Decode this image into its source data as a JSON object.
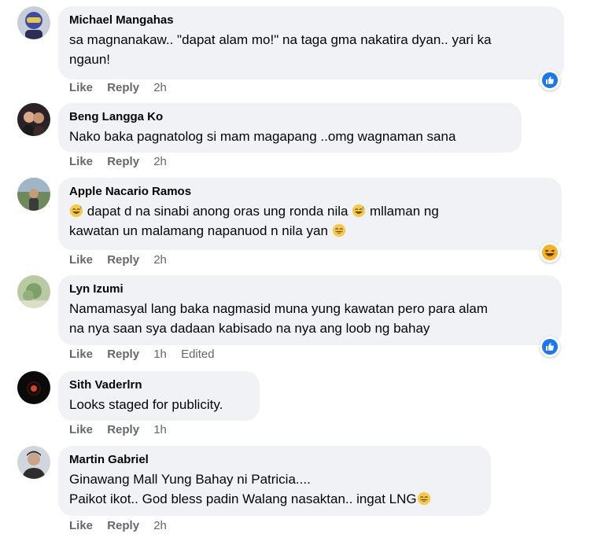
{
  "comments": [
    {
      "author": "Michael Mangahas",
      "text_line1": "sa magnanakaw.. \"dapat alam mo!\" na taga gma nakatira dyan.. yari ka",
      "text_line2": "ngaun!",
      "like_label": "Like",
      "reply_label": "Reply",
      "time": "2h",
      "reaction": "like-icon"
    },
    {
      "author": "Beng Langga Ko",
      "text_line1": "Nako baka pagnatolog si mam magapang ..omg wagnaman sana",
      "like_label": "Like",
      "reply_label": "Reply",
      "time": "2h"
    },
    {
      "author": "Apple Nacario Ramos",
      "text_line1_a": " dapat d na sinabi anong oras ung ronda nila ",
      "text_line1_b": " mllaman ng",
      "text_line2": "kawatan un malamang napanuod n nila yan ",
      "like_label": "Like",
      "reply_label": "Reply",
      "time": "2h",
      "reaction": "haha-icon"
    },
    {
      "author": "Lyn Izumi",
      "text_line1": "Namamasyal lang baka nagmasid muna yung kawatan pero para alam",
      "text_line2": "na nya saan sya dadaan kabisado na nya ang loob ng bahay",
      "like_label": "Like",
      "reply_label": "Reply",
      "time": "1h",
      "edited": "Edited",
      "reaction": "like-icon"
    },
    {
      "author": "Sith Vaderlrn",
      "text_line1": "Looks staged for publicity.",
      "like_label": "Like",
      "reply_label": "Reply",
      "time": "1h"
    },
    {
      "author": "Martin Gabriel",
      "text_line1": "Ginawang Mall Yung Bahay ni Patricia....",
      "text_line2": "Paikot ikot.. God bless padin Walang nasaktan.. ingat LNG",
      "like_label": "Like",
      "reply_label": "Reply",
      "time": "2h"
    }
  ],
  "colors": {
    "bubble": "#f0f2f5",
    "meta_text": "#65676b",
    "like_blue": "#1877f2",
    "haha_yellow": "#f7b125"
  }
}
